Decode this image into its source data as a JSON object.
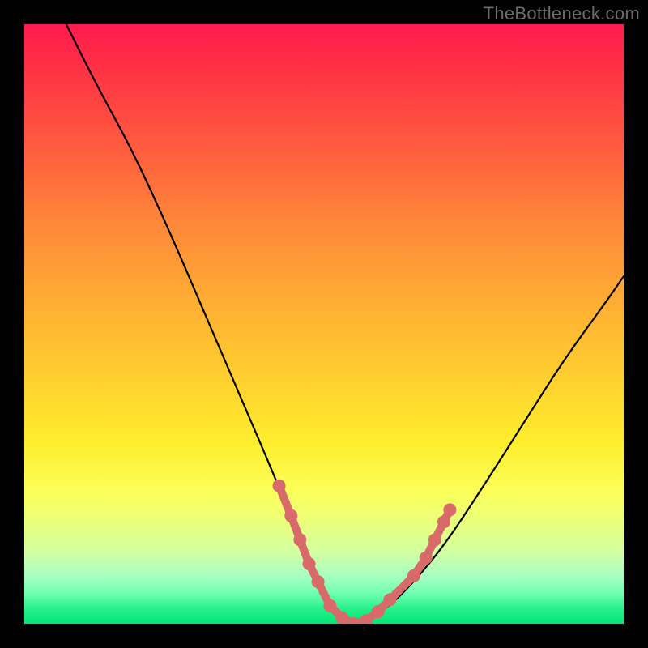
{
  "watermark": "TheBottleneck.com",
  "chart_data": {
    "type": "line",
    "title": "",
    "xlabel": "",
    "ylabel": "",
    "xlim": [
      0,
      100
    ],
    "ylim": [
      0,
      100
    ],
    "grid": false,
    "legend": false,
    "series": [
      {
        "name": "bottleneck-curve",
        "x": [
          7,
          12,
          18,
          24,
          30,
          36,
          42,
          46,
          49,
          51,
          53,
          55,
          58,
          61,
          65,
          70,
          76,
          83,
          90,
          98,
          100
        ],
        "y": [
          100,
          90,
          79,
          66,
          52,
          38,
          24,
          14,
          8,
          4,
          1,
          0,
          1,
          3,
          7,
          13,
          22,
          33,
          44,
          55,
          58
        ]
      }
    ],
    "markers": {
      "name": "highlight-beads",
      "color": "#d86a6a",
      "points": [
        {
          "x": 42.5,
          "y": 23
        },
        {
          "x": 44.5,
          "y": 18
        },
        {
          "x": 46,
          "y": 14
        },
        {
          "x": 47.5,
          "y": 10
        },
        {
          "x": 49,
          "y": 7
        },
        {
          "x": 51,
          "y": 3
        },
        {
          "x": 53,
          "y": 1
        },
        {
          "x": 55,
          "y": 0
        },
        {
          "x": 57,
          "y": 0.5
        },
        {
          "x": 59,
          "y": 2
        },
        {
          "x": 61,
          "y": 4
        },
        {
          "x": 65,
          "y": 8
        },
        {
          "x": 67,
          "y": 11
        },
        {
          "x": 68.5,
          "y": 14
        },
        {
          "x": 70,
          "y": 17
        },
        {
          "x": 71,
          "y": 19
        }
      ]
    },
    "background": {
      "type": "vertical-gradient",
      "stops": [
        {
          "pos": 0,
          "color": "#ff1a4d"
        },
        {
          "pos": 0.5,
          "color": "#ffb233"
        },
        {
          "pos": 0.78,
          "color": "#fbff5a"
        },
        {
          "pos": 1.0,
          "color": "#00e676"
        }
      ]
    }
  }
}
